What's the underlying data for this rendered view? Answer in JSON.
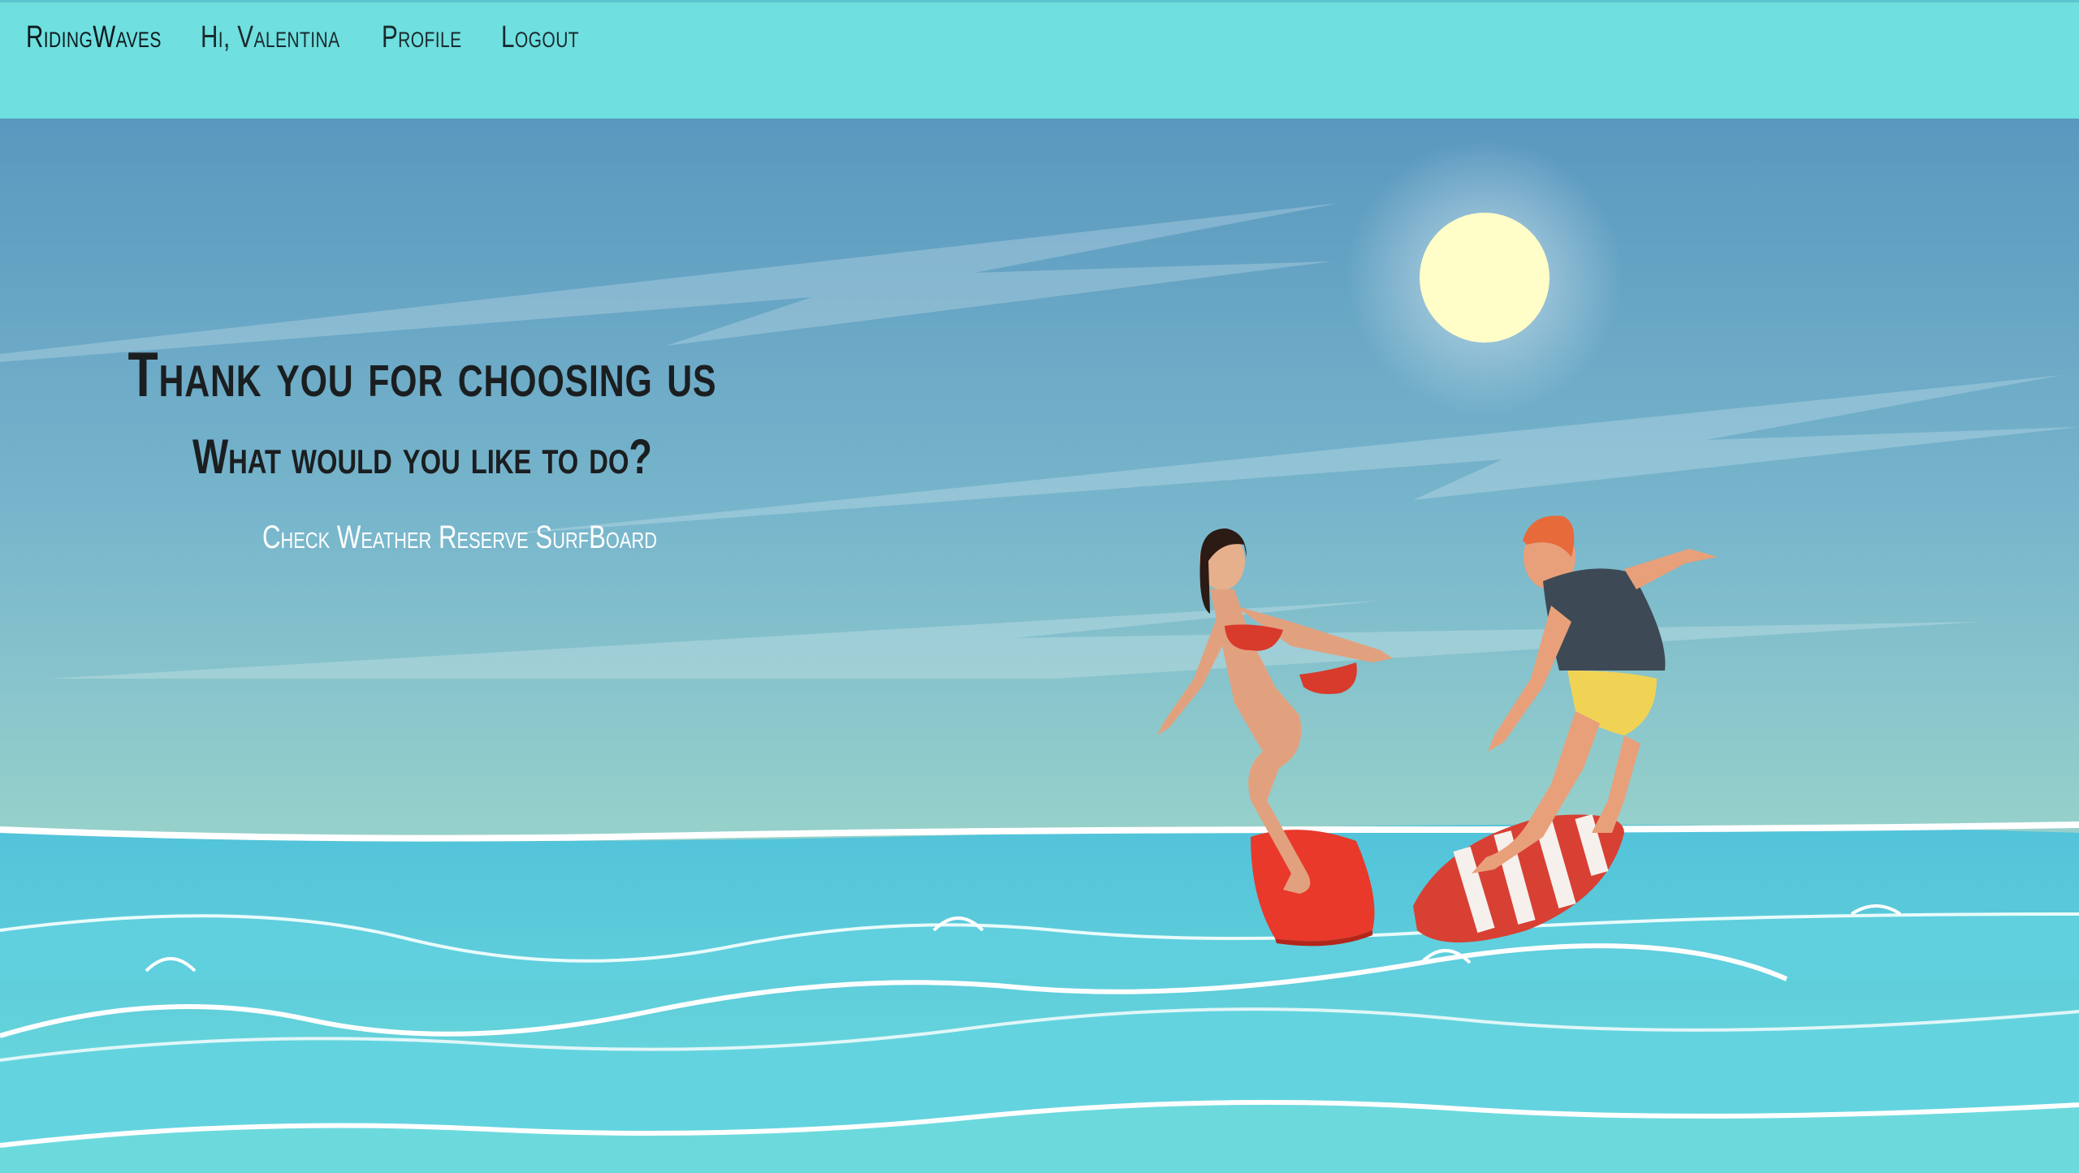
{
  "nav": {
    "brand": "RidingWaves",
    "greeting": "Hi, Valentina",
    "profile": "Profile",
    "logout": "Logout"
  },
  "hero": {
    "title": "Thank you for choosing us",
    "subtitle": "What would you like to do?",
    "actions": {
      "check_weather": "Check Weather",
      "reserve_surfboard": "Reserve SurfBoard"
    }
  },
  "colors": {
    "navbar": "#6fdfdf",
    "sky_top": "#5a9abf",
    "sky_bottom": "#95d0cb",
    "sea": "#5ccfdc",
    "sun": "#fffdc8"
  }
}
